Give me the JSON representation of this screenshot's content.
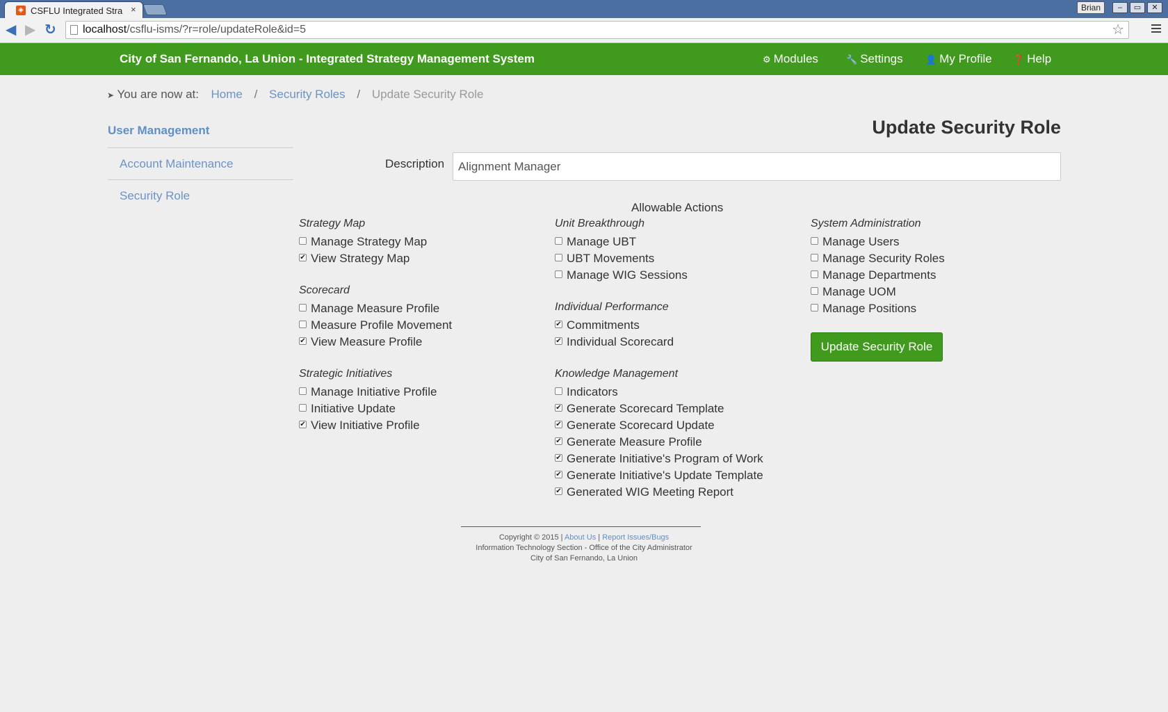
{
  "browser": {
    "tab_title": "CSFLU Integrated Stra",
    "tab_close": "×",
    "favicon": "◈",
    "url_host": "localhost",
    "url_path": "/csflu-isms/?r=role/updateRole&id=5",
    "user": "Brian",
    "win_minimize": "–",
    "win_restore": "▭",
    "win_close": "✕",
    "back": "◀",
    "forward": "▶",
    "reload": "↻",
    "star": "☆"
  },
  "header": {
    "brand": "City of San Fernando, La Union - Integrated Strategy Management System",
    "nav": [
      {
        "label": "Modules",
        "icon": "⚙"
      },
      {
        "label": "Settings",
        "icon": "🔧"
      },
      {
        "label": "My Profile",
        "icon": "👤"
      },
      {
        "label": "Help",
        "icon": "❓"
      }
    ]
  },
  "breadcrumb": {
    "prefix": "You are now at:",
    "icon": "➤",
    "items": [
      "Home",
      "Security Roles"
    ],
    "sep": "/",
    "current": "Update Security Role"
  },
  "sidebar": {
    "heading": "User Management",
    "items": [
      "Account Maintenance",
      "Security Role"
    ]
  },
  "form": {
    "title": "Update Security Role",
    "description_label": "Description",
    "description_value": "Alignment Manager",
    "allowable_heading": "Allowable Actions",
    "submit_label": "Update Security Role",
    "columns": [
      [
        {
          "title": "Strategy Map",
          "items": [
            {
              "label": "Manage Strategy Map",
              "checked": false
            },
            {
              "label": "View Strategy Map",
              "checked": true
            }
          ]
        },
        {
          "title": "Scorecard",
          "items": [
            {
              "label": "Manage Measure Profile",
              "checked": false
            },
            {
              "label": "Measure Profile Movement",
              "checked": false
            },
            {
              "label": "View Measure Profile",
              "checked": true
            }
          ]
        },
        {
          "title": "Strategic Initiatives",
          "items": [
            {
              "label": "Manage Initiative Profile",
              "checked": false
            },
            {
              "label": "Initiative Update",
              "checked": false
            },
            {
              "label": "View Initiative Profile",
              "checked": true
            }
          ]
        }
      ],
      [
        {
          "title": "Unit Breakthrough",
          "items": [
            {
              "label": "Manage UBT",
              "checked": false
            },
            {
              "label": "UBT Movements",
              "checked": false
            },
            {
              "label": "Manage WIG Sessions",
              "checked": false
            }
          ]
        },
        {
          "title": "Individual Performance",
          "items": [
            {
              "label": "Commitments",
              "checked": true
            },
            {
              "label": "Individual Scorecard",
              "checked": true
            }
          ]
        },
        {
          "title": "Knowledge Management",
          "items": [
            {
              "label": "Indicators",
              "checked": false
            },
            {
              "label": "Generate Scorecard Template",
              "checked": true
            },
            {
              "label": "Generate Scorecard Update",
              "checked": true
            },
            {
              "label": "Generate Measure Profile",
              "checked": true
            },
            {
              "label": "Generate Initiative's Program of Work",
              "checked": true
            },
            {
              "label": "Generate Initiative's Update Template",
              "checked": true
            },
            {
              "label": "Generated WIG Meeting Report",
              "checked": true
            }
          ]
        }
      ],
      [
        {
          "title": "System Administration",
          "items": [
            {
              "label": "Manage Users",
              "checked": false
            },
            {
              "label": "Manage Security Roles",
              "checked": false
            },
            {
              "label": "Manage Departments",
              "checked": false
            },
            {
              "label": "Manage UOM",
              "checked": false
            },
            {
              "label": "Manage Positions",
              "checked": false
            }
          ]
        }
      ]
    ]
  },
  "footer": {
    "copyright": "Copyright © 2015",
    "about": "About Us",
    "report": "Report Issues/Bugs",
    "pipe": "|",
    "line2": "Information Technology Section - Office of the City Administrator",
    "line3": "City of San Fernando, La Union"
  }
}
